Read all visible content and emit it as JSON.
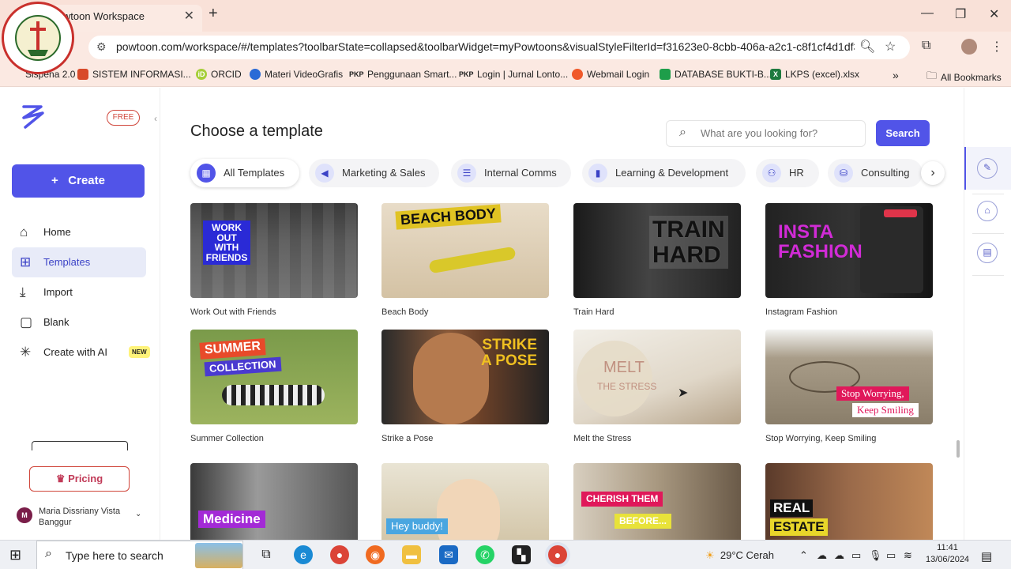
{
  "browser": {
    "tab_title": "Powtoon Workspace",
    "url": "powtoon.com/workspace/#/templates?toolbarState=collapsed&toolbarWidget=myPowtoons&visualStyleFilterId=f31623e0-8cbb-406a-a2c1-c8f1cf4d1df3&flow...",
    "bookmarks": [
      {
        "label": "Sispena 2.0",
        "icon_color": "#2a6ad6"
      },
      {
        "label": "SISTEM INFORMASI...",
        "icon_color": "#d84a2a"
      },
      {
        "label": "ORCID",
        "icon_color": "#a6ce39"
      },
      {
        "label": "Materi VideoGrafis",
        "icon_color": "#2a6ad6"
      },
      {
        "label": "Penggunaan Smart...",
        "icon_text": "PKP"
      },
      {
        "label": "Login | Jurnal Lonto...",
        "icon_text": "PKP"
      },
      {
        "label": "Webmail Login",
        "icon_color": "#f0592a"
      },
      {
        "label": "DATABASE BUKTI-B...",
        "icon_color": "#1e9e4a"
      },
      {
        "label": "LKPS (excel).xlsx",
        "icon_color": "#1e7a3e"
      }
    ],
    "all_bookmarks": "All Bookmarks"
  },
  "sidebar": {
    "free_badge": "FREE",
    "create_label": "Create",
    "nav": [
      {
        "label": "Home",
        "icon": "home-icon"
      },
      {
        "label": "Templates",
        "icon": "templates-icon"
      },
      {
        "label": "Import",
        "icon": "import-icon"
      },
      {
        "label": "Blank",
        "icon": "blank-icon"
      },
      {
        "label": "Create with AI",
        "icon": "ai-sparkle-icon"
      }
    ],
    "new_badge": "NEW",
    "pricing_label": "Pricing",
    "user_initial": "M",
    "user_name": "Maria Dissriany Vista Banggur"
  },
  "main": {
    "title": "Choose a template",
    "search_placeholder": "What are you looking for?",
    "search_button": "Search",
    "categories": [
      {
        "label": "All Templates",
        "active": true
      },
      {
        "label": "Marketing & Sales",
        "active": false
      },
      {
        "label": "Internal Comms",
        "active": false
      },
      {
        "label": "Learning & Development",
        "active": false
      },
      {
        "label": "HR",
        "active": false
      },
      {
        "label": "Consulting",
        "active": false
      }
    ],
    "templates": [
      {
        "title": "Work Out with Friends",
        "overlay": "WORK\nOUT\nWITH\nFRIENDS"
      },
      {
        "title": "Beach Body",
        "overlay": "BEACH BODY"
      },
      {
        "title": "Train Hard",
        "overlay": "TRAIN\nHARD"
      },
      {
        "title": "Instagram Fashion",
        "overlay": "INSTA\nFASHION"
      },
      {
        "title": "Summer Collection",
        "overlay": "SUMMER",
        "overlay2": "COLLECTION"
      },
      {
        "title": "Strike a Pose",
        "overlay": "STRIKE\nA POSE"
      },
      {
        "title": "Melt the Stress",
        "overlay": "MELT",
        "overlay2": "THE STRESS"
      },
      {
        "title": "Stop Worrying, Keep Smiling",
        "overlay": "Stop Worrying,",
        "overlay2": "Keep Smiling"
      },
      {
        "title": "Medicine",
        "overlay": "Medicine"
      },
      {
        "title": "Hey buddy!",
        "overlay": "Hey buddy!"
      },
      {
        "title": "Cherish Them Before",
        "overlay": "CHERISH THEM",
        "overlay2": "BEFORE..."
      },
      {
        "title": "Real Estate",
        "overlay": "REAL",
        "overlay2": "ESTATE"
      }
    ]
  },
  "taskbar": {
    "search_placeholder": "Type here to search",
    "weather": "29°C  Cerah",
    "time": "11:41",
    "date": "13/06/2024"
  }
}
